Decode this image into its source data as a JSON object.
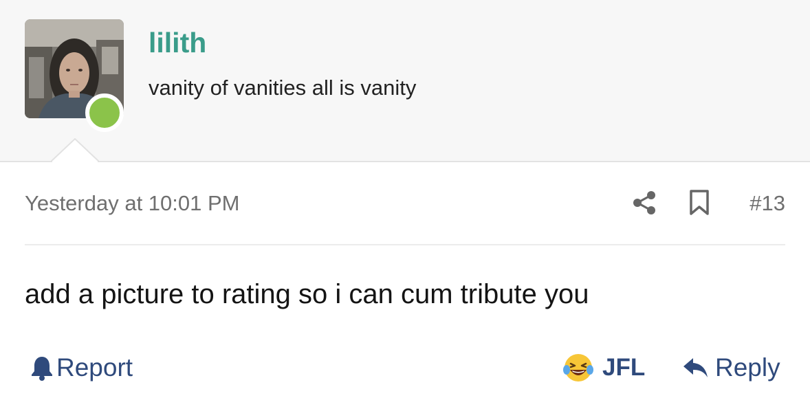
{
  "user": {
    "name": "lilith",
    "title": "vanity of vanities all is vanity",
    "status": "online",
    "status_color": "#8bc34a",
    "name_color": "#3a9c8a"
  },
  "post": {
    "timestamp": "Yesterday at 10:01 PM",
    "number": "#13",
    "body": "add a picture to rating so i can cum tribute you"
  },
  "actions": {
    "report_label": "Report",
    "report_icon": "bell-icon",
    "reaction_label": "JFL",
    "reaction_icon": "laughing-crying-face-icon",
    "reply_label": "Reply",
    "reply_icon": "reply-arrow-icon",
    "share_icon": "share-icon",
    "bookmark_icon": "bookmark-icon"
  },
  "colors": {
    "action_text": "#2f4a7c",
    "meta_text": "#6f6f6f",
    "header_bg": "#f7f7f7"
  }
}
